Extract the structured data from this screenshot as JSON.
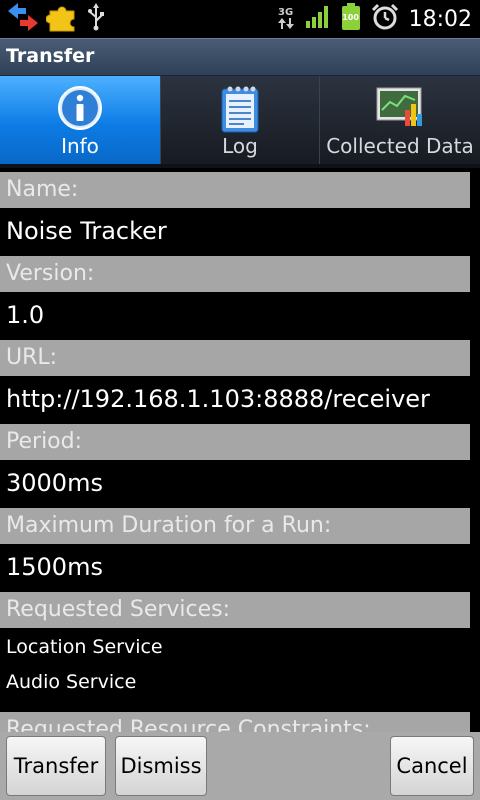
{
  "status_bar": {
    "time": "18:02",
    "network_type": "3G",
    "battery_level": "100",
    "icons": [
      "transfer-arrows-icon",
      "puzzle-icon",
      "usb-icon",
      "signal-icon",
      "battery-icon",
      "alarm-icon"
    ]
  },
  "title_bar": {
    "title": "Transfer"
  },
  "tabs": [
    {
      "label": "Info",
      "icon": "info-icon",
      "active": true
    },
    {
      "label": "Log",
      "icon": "notepad-icon",
      "active": false
    },
    {
      "label": "Collected Data",
      "icon": "chart-icon",
      "active": false
    }
  ],
  "fields": [
    {
      "label": "Name:",
      "value": "Noise Tracker"
    },
    {
      "label": "Version:",
      "value": "1.0"
    },
    {
      "label": "URL:",
      "value": "http://192.168.1.103:8888/receiver"
    },
    {
      "label": "Period:",
      "value": "3000ms"
    },
    {
      "label": "Maximum Duration for a Run:",
      "value": "1500ms"
    },
    {
      "label": "Requested Services:",
      "items": [
        "Location Service",
        "Audio Service"
      ]
    },
    {
      "label": "Requested Resource Constraints:"
    }
  ],
  "buttons": {
    "transfer": "Transfer",
    "dismiss": "Dismiss",
    "cancel": "Cancel"
  },
  "colors": {
    "tab_active": "#1888f0",
    "field_header": "#a6a6a6",
    "title_bar": "#3d4e66"
  }
}
